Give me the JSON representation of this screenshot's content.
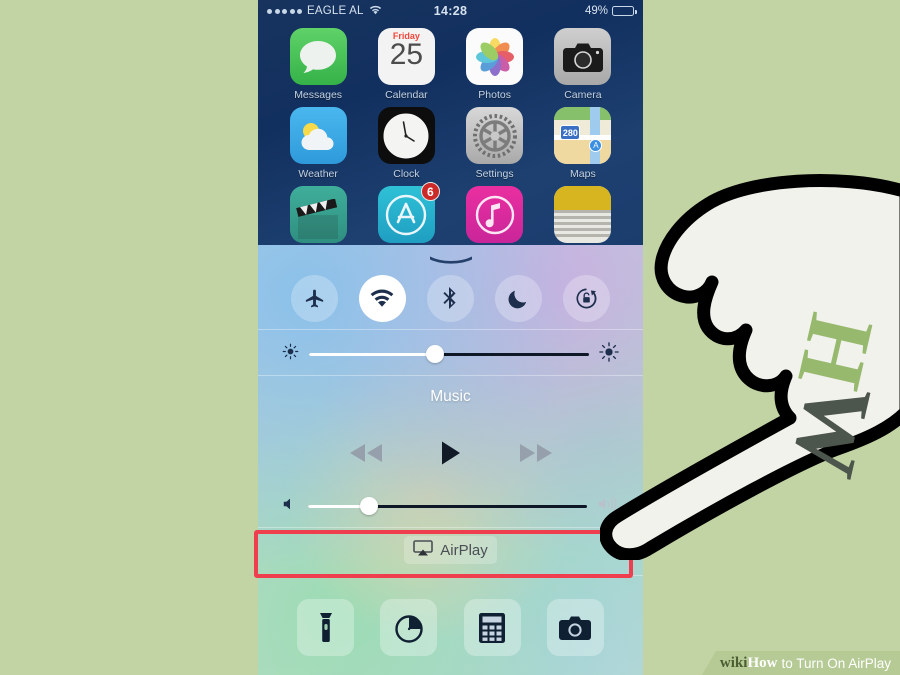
{
  "background_color": "#c2d4a4",
  "accent_highlight_color": "#ef3f4f",
  "phone": {
    "status_bar": {
      "signal_dots": 5,
      "carrier": "EAGLE AL",
      "wifi_icon": "wifi-icon",
      "time": "14:28",
      "battery_percent": "49%",
      "battery_level": 49
    },
    "home_screen": {
      "apps": [
        {
          "label": "Messages",
          "icon": "messages-icon",
          "badge": ""
        },
        {
          "label": "Calendar",
          "icon": "calendar-icon",
          "badge": "",
          "weekday": "Friday",
          "day": "25"
        },
        {
          "label": "Photos",
          "icon": "photos-icon",
          "badge": ""
        },
        {
          "label": "Camera",
          "icon": "camera-icon",
          "badge": ""
        },
        {
          "label": "Weather",
          "icon": "weather-icon",
          "badge": ""
        },
        {
          "label": "Clock",
          "icon": "clock-icon",
          "badge": ""
        },
        {
          "label": "Settings",
          "icon": "settings-icon",
          "badge": ""
        },
        {
          "label": "Maps",
          "icon": "maps-icon",
          "badge": "",
          "route_shield": "280"
        },
        {
          "label": "Videos",
          "icon": "videos-icon",
          "badge": ""
        },
        {
          "label": "App Store",
          "icon": "app-store-icon",
          "badge": "6"
        },
        {
          "label": "iTunes Store",
          "icon": "itunes-icon",
          "badge": ""
        },
        {
          "label": "Newsstand",
          "icon": "newsstand-icon",
          "badge": ""
        }
      ]
    },
    "control_center": {
      "grabber": "grabber-handle",
      "toggles": [
        {
          "name": "airplane-mode",
          "icon": "airplane-icon",
          "active": false
        },
        {
          "name": "wifi",
          "icon": "wifi-icon",
          "active": true
        },
        {
          "name": "bluetooth",
          "icon": "bluetooth-icon",
          "active": false
        },
        {
          "name": "do-not-disturb",
          "icon": "moon-icon",
          "active": false
        },
        {
          "name": "rotation-lock",
          "icon": "rotation-lock-icon",
          "active": false
        }
      ],
      "brightness": {
        "name": "brightness-slider",
        "value": 45,
        "low_icon": "brightness-low-icon",
        "high_icon": "brightness-high-icon"
      },
      "music": {
        "title": "Music",
        "controls": [
          {
            "name": "rewind",
            "icon": "rewind-icon"
          },
          {
            "name": "play",
            "icon": "play-icon"
          },
          {
            "name": "forward",
            "icon": "fast-forward-icon"
          }
        ]
      },
      "volume": {
        "name": "volume-slider",
        "value": 22,
        "low_icon": "volume-low-icon",
        "high_icon": "volume-high-icon"
      },
      "airplay": {
        "label": "AirPlay",
        "icon": "airplay-icon",
        "highlighted": true
      },
      "shortcuts": [
        {
          "name": "flashlight",
          "icon": "flashlight-icon"
        },
        {
          "name": "timer",
          "icon": "timer-icon"
        },
        {
          "name": "calculator",
          "icon": "calculator-icon"
        },
        {
          "name": "camera",
          "icon": "camera-icon"
        }
      ]
    }
  },
  "hand_cursor": {
    "icon": "pointing-hand-icon",
    "letter_h": "H",
    "letter_w": "W"
  },
  "watermark": {
    "wiki": "wiki",
    "how": "How",
    "tail": "to Turn On AirPlay"
  }
}
